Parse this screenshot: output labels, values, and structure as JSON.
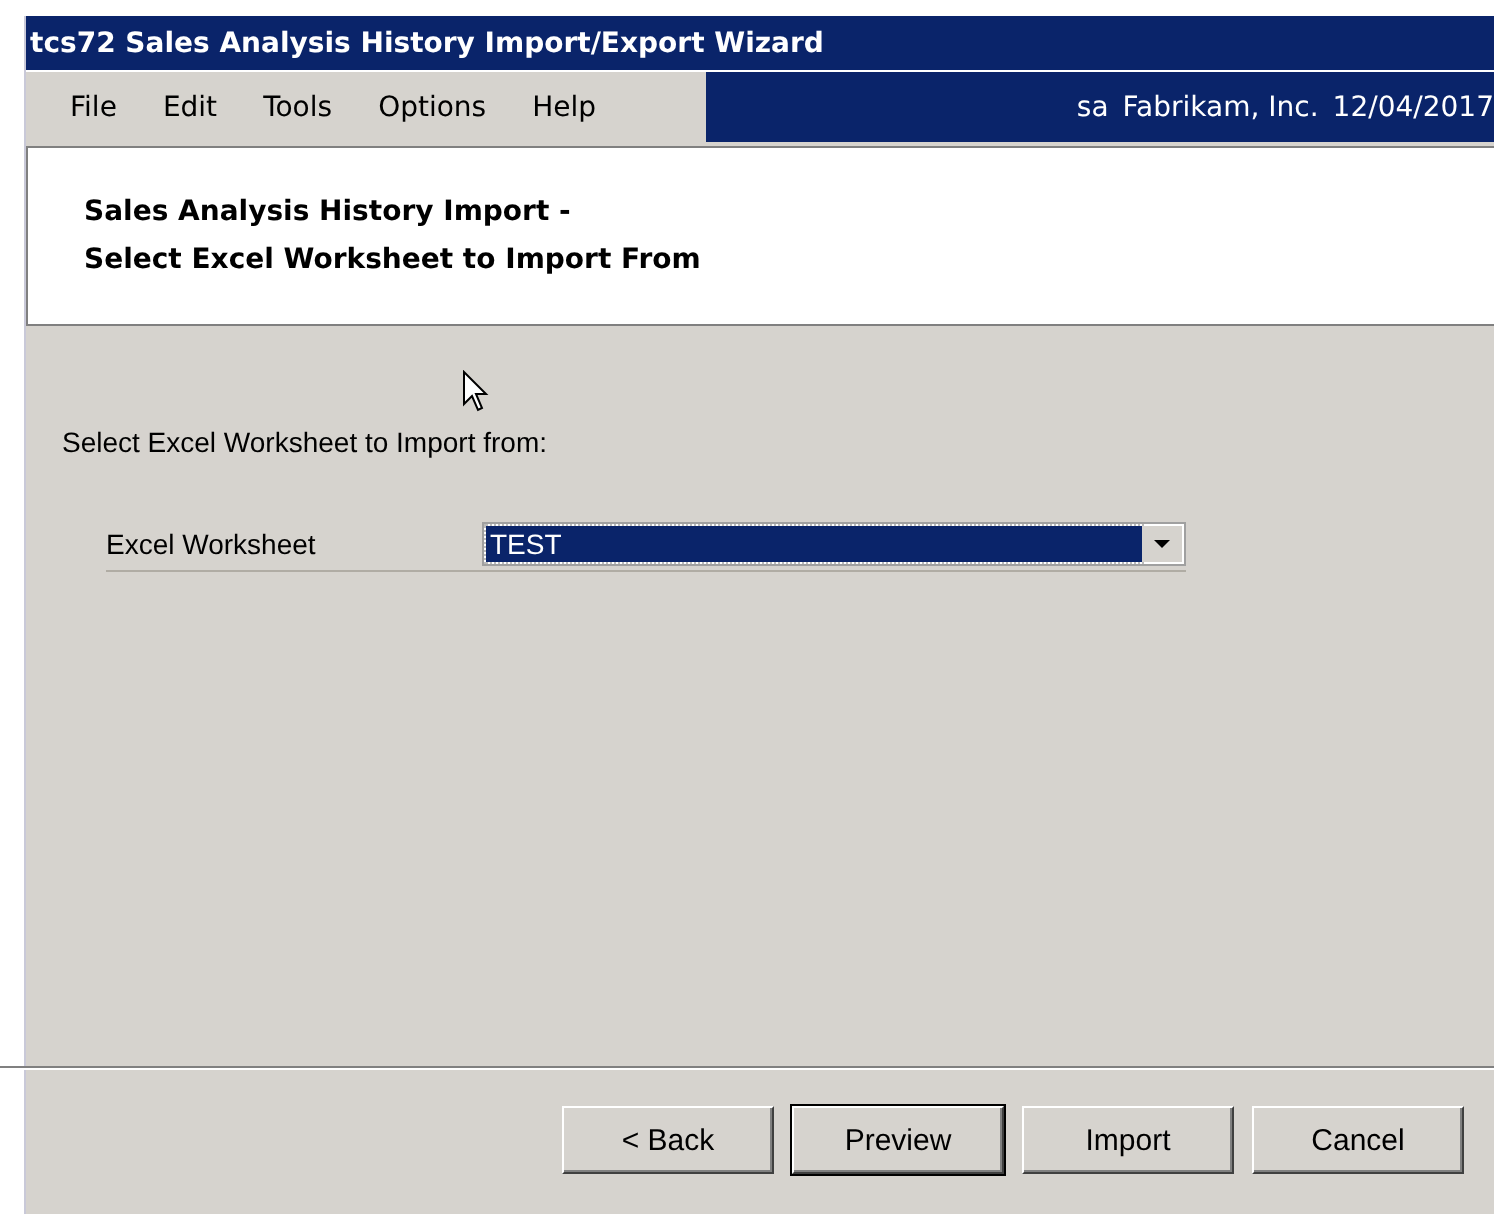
{
  "window": {
    "title": "tcs72 Sales Analysis History Import/Export Wizard"
  },
  "menu": [
    "File",
    "Edit",
    "Tools",
    "Options",
    "Help"
  ],
  "status": {
    "user": "sa",
    "company": "Fabrikam, Inc.",
    "date": "12/04/2017"
  },
  "header": {
    "line_1": "Sales Analysis History Import -",
    "line_2": "Select Excel Worksheet to Import From"
  },
  "instruction": "Select Excel Worksheet to Import from:",
  "worksheet_field": {
    "label": "Excel Worksheet",
    "value": "TEST",
    "selected": true
  },
  "buttons": [
    {
      "label": "< Back",
      "default": false
    },
    {
      "label": "Preview",
      "default": true
    },
    {
      "label": "Import",
      "default": false
    },
    {
      "label": "Cancel",
      "default": false
    }
  ]
}
